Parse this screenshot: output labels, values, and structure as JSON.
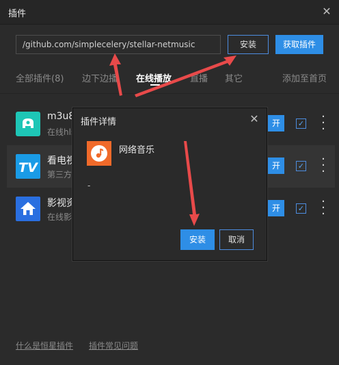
{
  "window": {
    "title": "插件"
  },
  "search": {
    "value": "/github.com/simplecelery/stellar-netmusic",
    "placeholder": ""
  },
  "buttons": {
    "install": "安装",
    "get_plugins": "获取插件"
  },
  "tabs": [
    {
      "label": "全部插件(8)",
      "active": false
    },
    {
      "label": "边下边播",
      "active": false
    },
    {
      "label": "在线播放",
      "active": true
    },
    {
      "label": "直播",
      "active": false
    },
    {
      "label": "其它",
      "active": false
    }
  ],
  "add_to_home": "添加至首页",
  "plugins": [
    {
      "name": "m3u8",
      "desc": "在线hls",
      "action": "开",
      "icon": "m3u8-icon",
      "checked": true
    },
    {
      "name": "看电视",
      "desc": "第三方",
      "action": "开",
      "icon": "tv-icon",
      "checked": true
    },
    {
      "name": "影视资",
      "desc": "在线影",
      "action": "开",
      "icon": "home-icon",
      "checked": true
    }
  ],
  "footer": {
    "what_is": "什么是恒星插件",
    "faq": "插件常见问题"
  },
  "modal": {
    "title": "插件详情",
    "plugin_name": "网络音乐",
    "description": "-",
    "install": "安装",
    "cancel": "取消",
    "icon": "music-note-icon"
  },
  "colors": {
    "accent": "#2e8ee6",
    "arrow": "#e84a4a",
    "music_icon": "#f06a2a",
    "m3u8_icon": "#1ec6b6",
    "tv_icon": "#1a9be6",
    "home_icon": "#2a6fe0"
  }
}
